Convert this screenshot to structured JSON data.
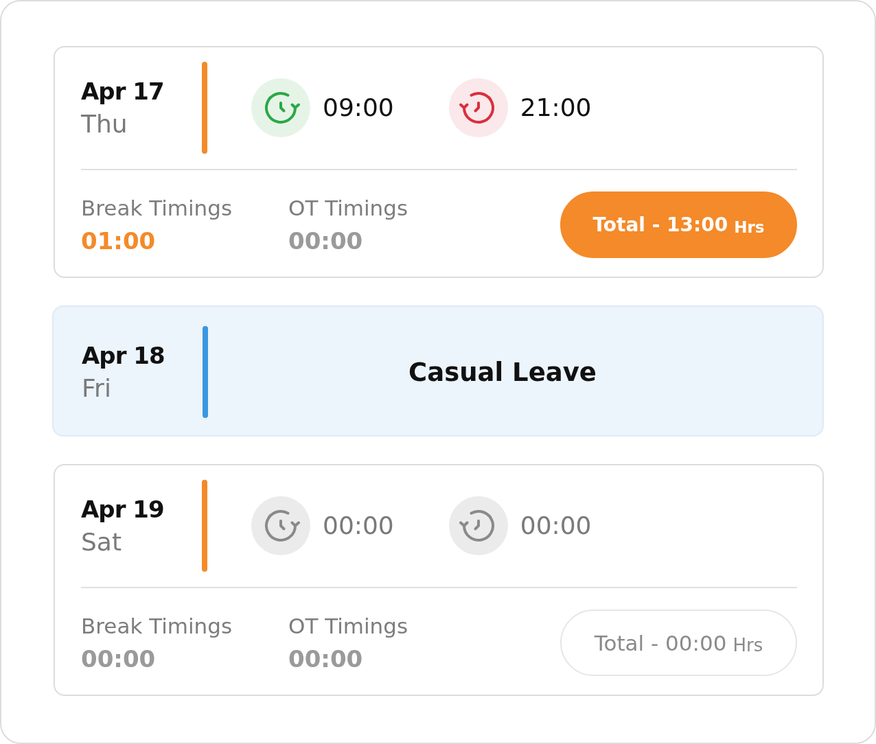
{
  "days": [
    {
      "kind": "work",
      "date": "Apr 17",
      "weekday": "Thu",
      "color": "#f48a29",
      "punch_in": {
        "time": "09:00",
        "active": true
      },
      "punch_out": {
        "time": "21:00",
        "active": true
      },
      "break": {
        "label": "Break Timings",
        "value": "01:00",
        "highlighted": true
      },
      "ot": {
        "label": "OT Timings",
        "value": "00:00",
        "highlighted": false
      },
      "total": {
        "text": "Total - 13:00",
        "unit": "Hrs",
        "filled": true
      }
    },
    {
      "kind": "leave",
      "date": "Apr 18",
      "weekday": "Fri",
      "color": "#3a97e0",
      "label": "Casual Leave"
    },
    {
      "kind": "work",
      "date": "Apr 19",
      "weekday": "Sat",
      "color": "#f48a29",
      "punch_in": {
        "time": "00:00",
        "active": false
      },
      "punch_out": {
        "time": "00:00",
        "active": false
      },
      "break": {
        "label": "Break Timings",
        "value": "00:00",
        "highlighted": false
      },
      "ot": {
        "label": "OT Timings",
        "value": "00:00",
        "highlighted": false
      },
      "total": {
        "text": "Total - 00:00",
        "unit": "Hrs",
        "filled": false
      }
    }
  ]
}
